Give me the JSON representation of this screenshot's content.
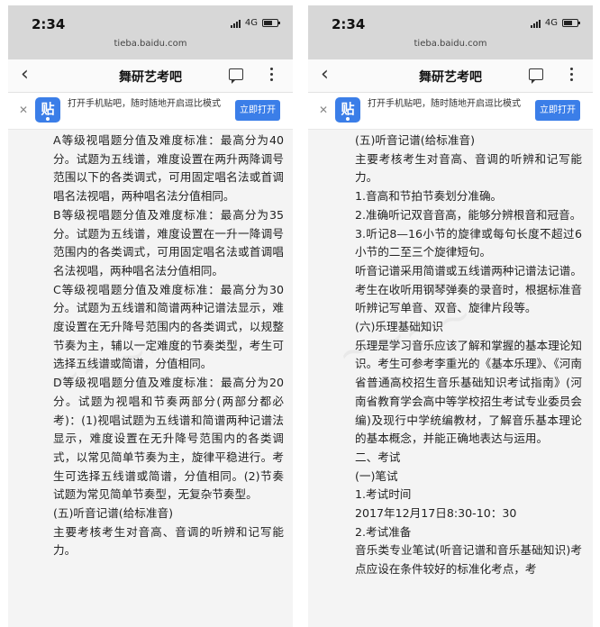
{
  "status": {
    "time": "2:34",
    "network": "4G",
    "url": "tieba.baidu.com"
  },
  "nav": {
    "title": "舞研艺考吧"
  },
  "banner": {
    "logo_text": "贴",
    "text": "打开手机贴吧，随时随地开启逗比模式",
    "open_label": "立即打开"
  },
  "left_paragraphs": [
    "A等级视唱题分值及难度标准：最高分为40分。试题为五线谱，难度设置在两升两降调号范围以下的各类调式，可用固定唱名法或首调唱名法视唱，两种唱名法分值相同。",
    "B等级视唱题分值及难度标准：最高分为35分。试题为五线谱，难度设置在一升一降调号范围内的各类调式，可用固定唱名法或首调唱名法视唱，两种唱名法分值相同。",
    "C等级视唱题分值及难度标准：最高分为30分。试题为五线谱和简谱两种记谱法显示，难度设置在无升降号范围内的各类调式，以规整节奏为主，辅以一定难度的节奏类型，考生可选择五线谱或简谱，分值相同。",
    "D等级视唱题分值及难度标准：最高分为20分。试题为视唱和节奏两部分(两部分都必考)：(1)视唱试题为五线谱和简谱两种记谱法显示，难度设置在无升降号范围内的各类调式，以常见简单节奏为主，旋律平稳进行。考生可选择五线谱或简谱，分值相同。(2)节奏试题为常见简单节奏型，无复杂节奏型。",
    "(五)听音记谱(给标准音)",
    "主要考核考生对音高、音调的听辨和记写能力。"
  ],
  "right_paragraphs": [
    "(五)听音记谱(给标准音)",
    "主要考核考生对音高、音调的听辨和记写能力。",
    "1.音高和节拍节奏划分准确。",
    "2.准确听记双音音高，能够分辨根音和冠音。",
    "3.听记8—16小节的旋律或每句长度不超过6小节的二至三个旋律短句。",
    "听音记谱采用简谱或五线谱两种记谱法记谱。考生在收听用钢琴弹奏的录音时，根据标准音听辨记写单音、双音、旋律片段等。",
    "(六)乐理基础知识",
    "乐理是学习音乐应该了解和掌握的基本理论知识。考生可参考李重光的《基本乐理》、《河南省普通高校招生音乐基础知识考试指南》(河南省教育学会高中等学校招生考试专业委员会编)及现行中学统编教材，了解音乐基本理论的基本概念，并能正确地表达与运用。",
    "二、考试",
    "(一)笔试",
    "1.考试时间",
    "2017年12月17日8:30-10：30",
    "2.考试准备",
    "音乐类专业笔试(听音记谱和音乐基础知识)考点应设在条件较好的标准化考点，考"
  ]
}
